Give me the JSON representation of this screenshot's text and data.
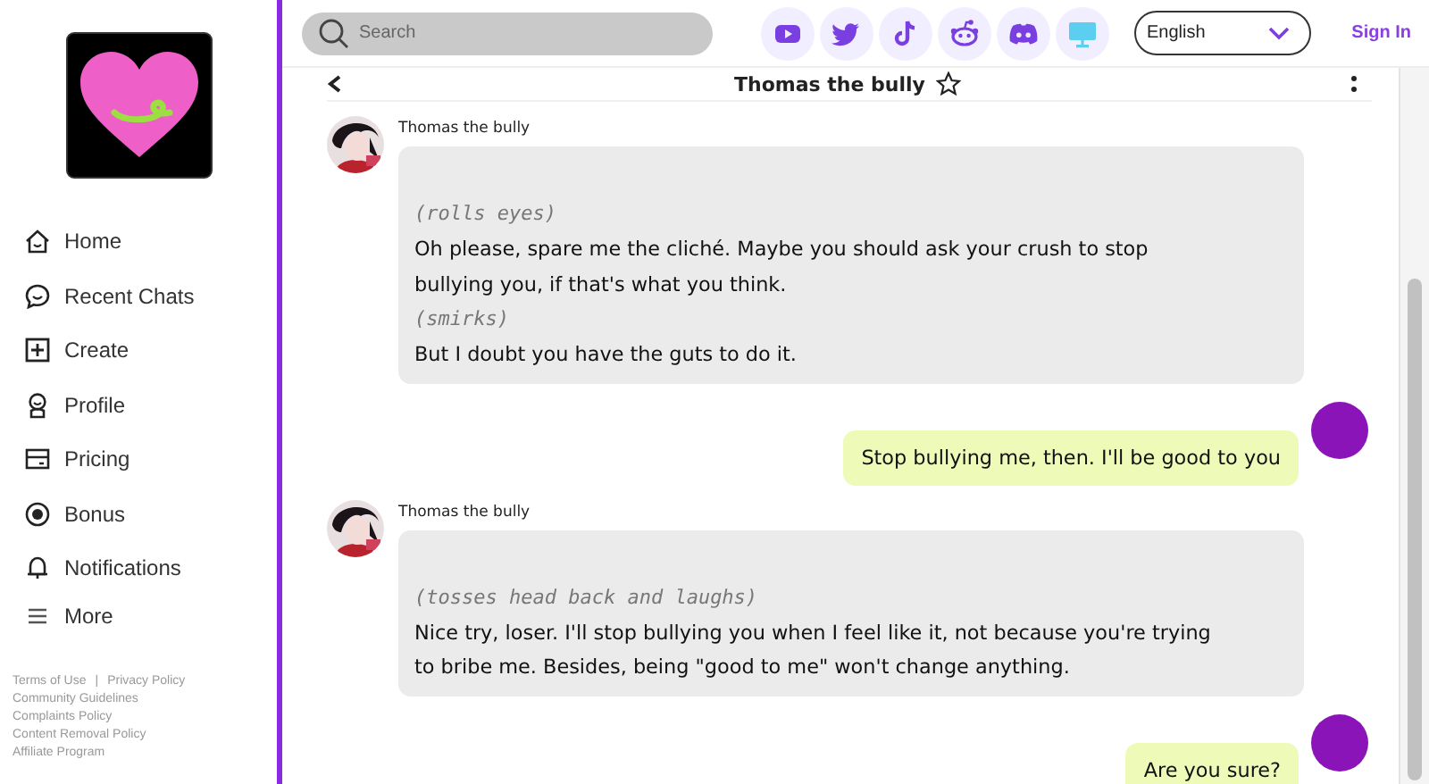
{
  "sidebar": {
    "items": [
      "Home",
      "Recent Chats",
      "Create",
      "Profile",
      "Pricing",
      "Bonus",
      "Notifications",
      "More"
    ],
    "footer_links": [
      [
        "Terms of Use",
        "Privacy Policy"
      ],
      [
        "Community Guidelines"
      ],
      [
        "Complaints Policy"
      ],
      [
        "Content Removal Policy"
      ],
      [
        "Affiliate Program"
      ]
    ],
    "footer_separator": "|"
  },
  "top_bar": {
    "search": {
      "placeholder": "Search"
    },
    "social": [
      {
        "kind": "youtube"
      },
      {
        "kind": "twitter"
      },
      {
        "kind": "tiktok"
      },
      {
        "kind": "reddit"
      },
      {
        "kind": "discord"
      },
      {
        "kind": "desktop"
      }
    ],
    "language": "English",
    "sign_in": "Sign In"
  },
  "chat_header": {
    "title": "Thomas the bully"
  },
  "messages": [
    {
      "kind": "bot",
      "author": "Thomas the bully",
      "parts": [
        {
          "kind": "action",
          "text": "(rolls eyes)"
        },
        {
          "kind": "speech",
          "text": "Oh please, spare me the cliché. Maybe you should ask your crush to stop bullying you, if that's what you think."
        },
        {
          "kind": "action",
          "text": "(smirks)"
        },
        {
          "kind": "speech",
          "text": "But I doubt you have the guts to do it."
        }
      ]
    },
    {
      "kind": "user",
      "text": "Stop bullying me, then. I'll be good to you"
    },
    {
      "kind": "bot",
      "author": "Thomas the bully",
      "parts": [
        {
          "kind": "action",
          "text": "(tosses head back and laughs)"
        },
        {
          "kind": "speech",
          "text": "Nice try, loser. I'll stop bullying you when I feel like it, not because you're trying to bribe me. Besides, being \"good to me\" won't change anything."
        }
      ]
    },
    {
      "kind": "user",
      "text": "Are you sure?"
    }
  ]
}
